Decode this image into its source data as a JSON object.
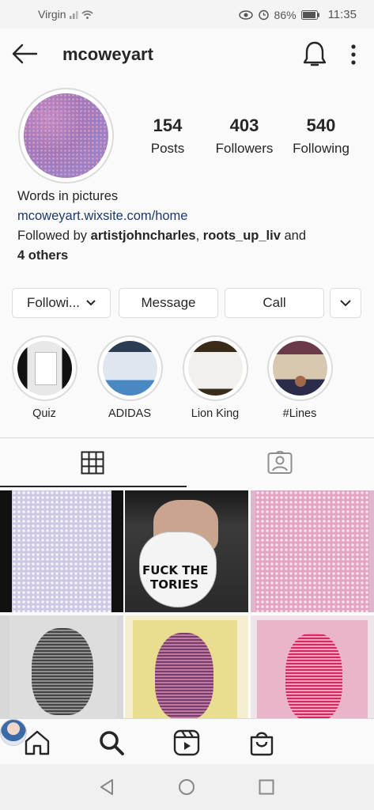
{
  "status_bar": {
    "carrier": "Virgin",
    "battery": "86%",
    "time": "11:35"
  },
  "header": {
    "username": "mcoweyart"
  },
  "profile": {
    "stats": [
      {
        "value": "154",
        "label": "Posts"
      },
      {
        "value": "403",
        "label": "Followers"
      },
      {
        "value": "540",
        "label": "Following"
      }
    ],
    "bio_name": "Words in pictures",
    "website": "mcoweyart.wixsite.com/home",
    "followed_by_prefix": "Followed by ",
    "followed_user_1": "artistjohncharles",
    "followed_sep": ", ",
    "followed_user_2": "roots_up_liv",
    "followed_and": " and",
    "followed_others": "4 others"
  },
  "actions": {
    "following_label": "Followi...",
    "message_label": "Message",
    "call_label": "Call"
  },
  "highlights": [
    {
      "label": "Quiz"
    },
    {
      "label": "ADIDAS"
    },
    {
      "label": "Lion King"
    },
    {
      "label": "#Lines"
    }
  ],
  "posts": {
    "mask_text_line1": "FUCK THE",
    "mask_text_line2": "TORIES"
  },
  "icons": {
    "back": "arrow-left-icon",
    "notifications": "bell-icon",
    "menu": "more-vertical-icon",
    "grid_tab": "grid-icon",
    "tagged_tab": "tagged-icon",
    "home": "home-icon",
    "search": "search-icon",
    "reels": "reels-icon",
    "shop": "shop-icon"
  }
}
